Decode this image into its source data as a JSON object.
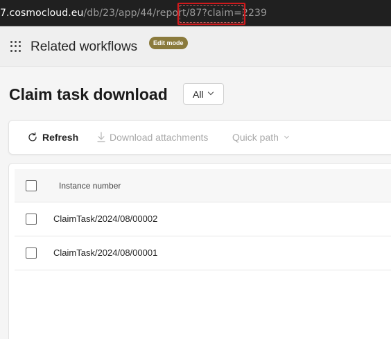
{
  "browser": {
    "url_host": "7.cosmocloud.eu",
    "url_path": "/db/23/app/44/report/87",
    "url_query": "?claim=2239"
  },
  "header": {
    "app_title": "Related workflows",
    "mode_badge": "Edit mode",
    "icon": "app-launcher-icon"
  },
  "main": {
    "page_title": "Claim task download",
    "filter": {
      "selected": "All"
    }
  },
  "toolbar": {
    "refresh_label": "Refresh",
    "download_label": "Download attachments",
    "quick_path_label": "Quick path"
  },
  "table": {
    "columns": [
      "Instance number"
    ],
    "rows": [
      {
        "instance_number": "ClaimTask/2024/08/00002"
      },
      {
        "instance_number": "ClaimTask/2024/08/00001"
      }
    ]
  },
  "colors": {
    "address_bar_bg": "#202020",
    "highlight_border": "#d0191c",
    "badge_bg": "#8a7a3c",
    "disabled_text": "#a9a9a9"
  }
}
